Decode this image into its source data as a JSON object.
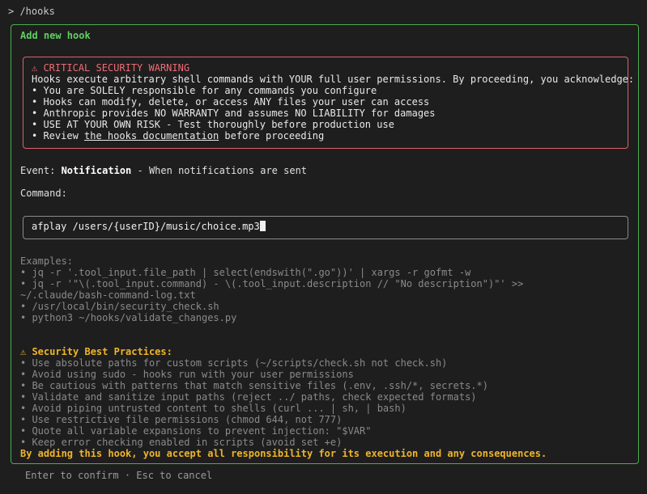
{
  "prompt": "> /hooks",
  "panel": {
    "title": "Add new hook"
  },
  "warning": {
    "heading": "⚠ CRITICAL SECURITY WARNING",
    "intro": "Hooks execute arbitrary shell commands with YOUR full user permissions. By proceeding, you acknowledge:",
    "items": [
      "• You are SOLELY responsible for any commands you configure",
      "• Hooks can modify, delete, or access ANY files your user can access",
      "• Anthropic provides NO WARRANTY and assumes NO LIABILITY for damages",
      "• USE AT YOUR OWN RISK - Test thoroughly before production use"
    ],
    "review_prefix": "• Review ",
    "review_link": "the hooks documentation",
    "review_suffix": " before proceeding"
  },
  "event": {
    "label": "Event: ",
    "name": "Notification",
    "description": " - When notifications are sent"
  },
  "command": {
    "label": "Command:",
    "value": "afplay /users/{userID}/music/choice.mp3"
  },
  "examples": {
    "heading": "Examples:",
    "lines": [
      "• jq -r '.tool_input.file_path | select(endswith(\".go\"))' | xargs -r gofmt -w",
      "• jq -r '\"\\(.tool_input.command) - \\(.tool_input.description // \"No description\")\"' >>",
      "~/.claude/bash-command-log.txt",
      "• /usr/local/bin/security_check.sh",
      "• python3 ~/hooks/validate_changes.py"
    ]
  },
  "practices": {
    "heading": "⚠ Security Best Practices:",
    "lines": [
      "• Use absolute paths for custom scripts (~/scripts/check.sh not check.sh)",
      "• Avoid using sudo - hooks run with your user permissions",
      "• Be cautious with patterns that match sensitive files (.env, .ssh/*, secrets.*)",
      "• Validate and sanitize input paths (reject ../ paths, check expected formats)",
      "• Avoid piping untrusted content to shells (curl ... | sh, | bash)",
      "• Use restrictive file permissions (chmod 644, not 777)",
      "• Quote all variable expansions to prevent injection: \"$VAR\"",
      "• Keep error checking enabled in scripts (avoid set +e)"
    ]
  },
  "accept_text": "By adding this hook, you accept all responsibility for its execution and any consequences.",
  "footer": "Enter to confirm · Esc to cancel",
  "colors": {
    "panel_border": "#4cae4f",
    "panel_title": "#5fcf63",
    "warning_border": "#d8636b",
    "warning_heading": "#ef6b73",
    "practices_heading": "#f0b429",
    "muted_text": "#8a8a8a",
    "background": "#1e1e1e"
  }
}
